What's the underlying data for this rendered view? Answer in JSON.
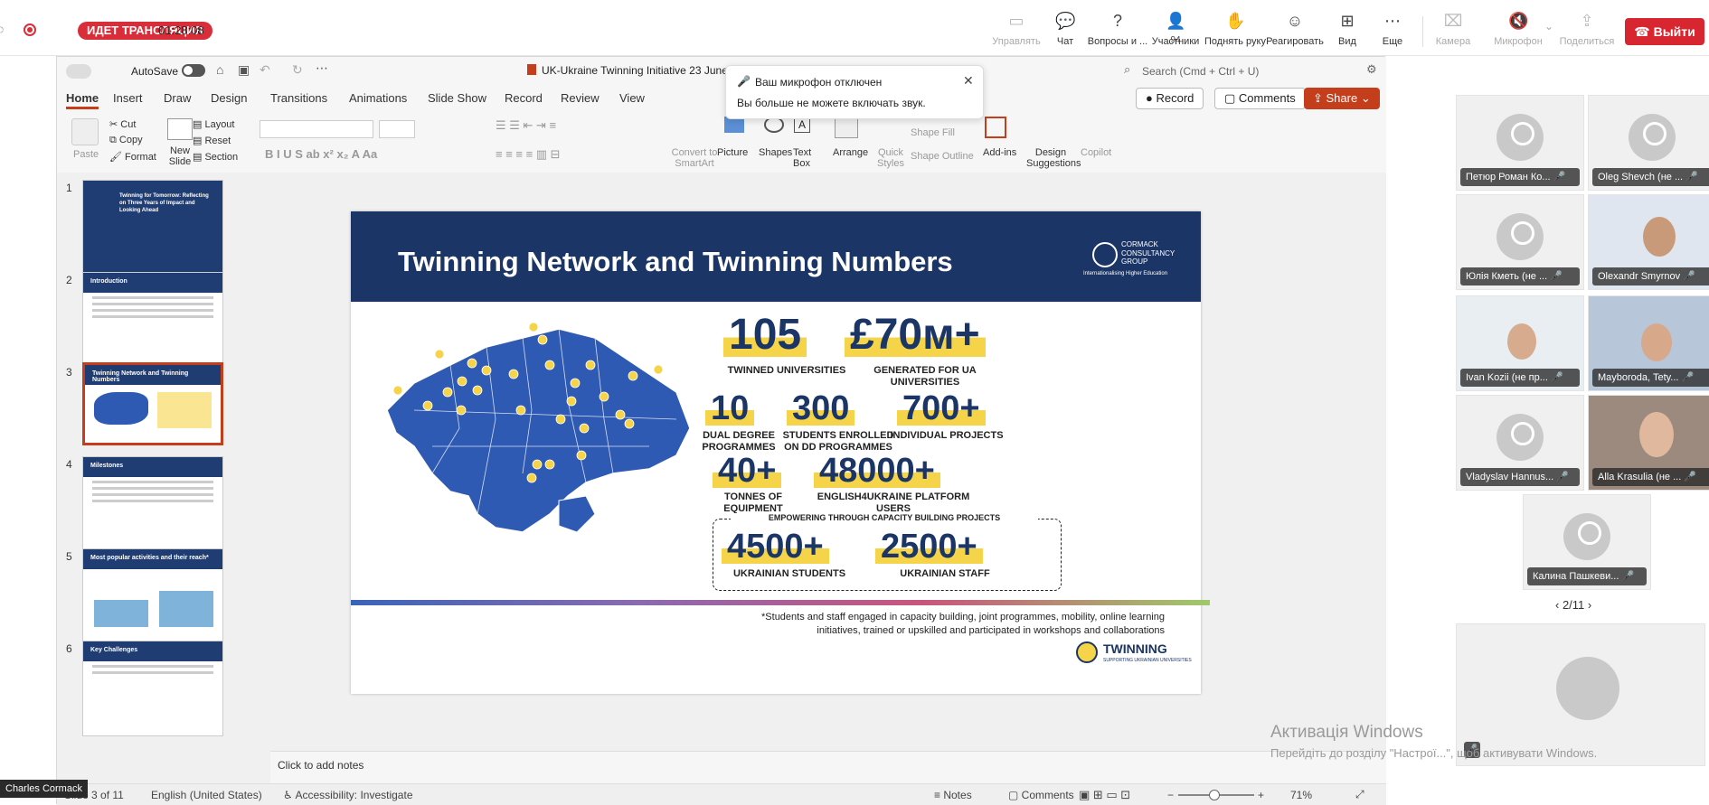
{
  "zoom": {
    "live_badge": "ИДЕТ ТРАНСЛЯЦИЯ",
    "elapsed": "01:28:08",
    "toolbar": [
      {
        "label": "Управлять",
        "icon": "share-screen-icon",
        "disabled": true
      },
      {
        "label": "Чат",
        "icon": "chat-icon"
      },
      {
        "label": "Вопросы и ...",
        "icon": "qa-icon"
      },
      {
        "label": "Участники",
        "icon": "participants-icon",
        "count": "94"
      },
      {
        "label": "Поднять руку",
        "icon": "raise-hand-icon"
      },
      {
        "label": "Реагировать",
        "icon": "smile-icon"
      },
      {
        "label": "Вид",
        "icon": "grid-view-icon"
      },
      {
        "label": "Еще",
        "icon": "more-icon"
      },
      {
        "label": "Камера",
        "icon": "camera-off-icon",
        "disabled": true
      },
      {
        "label": "Микрофон",
        "icon": "mic-off-icon",
        "disabled": true
      },
      {
        "label": "Поделиться",
        "icon": "share-icon",
        "disabled": true
      }
    ],
    "leave_label": "Выйти"
  },
  "ppt": {
    "autosave": "AutoSave",
    "doc_title": "UK-Ukraine Twinning Initiative 23 June",
    "search_placeholder": "Search (Cmd + Ctrl + U)",
    "record_label": "Record",
    "comments_label": "Comments",
    "share_label": "Share",
    "tabs": [
      "Home",
      "Insert",
      "Draw",
      "Design",
      "Transitions",
      "Animations",
      "Slide Show",
      "Record",
      "Review",
      "View"
    ],
    "ribbon": {
      "paste": "Paste",
      "cut": "Cut",
      "copy": "Copy",
      "format": "Format",
      "new_slide": "New Slide",
      "layout": "Layout",
      "reset": "Reset",
      "section": "Section",
      "convert": "Convert to SmartArt",
      "picture": "Picture",
      "shapes": "Shapes",
      "textbox": "Text Box",
      "arrange": "Arrange",
      "quick_styles": "Quick Styles",
      "shape_fill": "Shape Fill",
      "shape_outline": "Shape Outline",
      "addins": "Add-ins",
      "design_suggestions": "Design Suggestions",
      "copilot": "Copilot"
    },
    "popup": {
      "title": "Ваш микрофон отключен",
      "body": "Вы больше не можете включать звук."
    },
    "thumbnails": [
      {
        "n": "1",
        "title": "Twinning for Tomorrow: Reflecting on Three Years of Impact and Looking Ahead"
      },
      {
        "n": "2",
        "title": "Introduction"
      },
      {
        "n": "3",
        "title": "Twinning Network and Twinning Numbers"
      },
      {
        "n": "4",
        "title": "Milestones"
      },
      {
        "n": "5",
        "title": "Most popular activities and their reach*"
      },
      {
        "n": "6",
        "title": "Key Challenges"
      }
    ],
    "slide": {
      "title": "Twinning Network and Twinning Numbers",
      "logo_text": "CORMACK CONSULTANCY GROUP",
      "logo_sub": "Internationalising Higher Education",
      "stats": [
        {
          "value": "105",
          "caption": "TWINNED UNIVERSITIES"
        },
        {
          "value": "£70м+",
          "caption": "GENERATED FOR UA UNIVERSITIES"
        },
        {
          "value": "10",
          "caption": "DUAL DEGREE PROGRAMMES"
        },
        {
          "value": "300",
          "caption": "STUDENTS ENROLLED ON DD PROGRAMMES"
        },
        {
          "value": "700+",
          "caption": "INDIVIDUAL PROJECTS"
        },
        {
          "value": "40+",
          "caption": "TONNES OF EQUIPMENT"
        },
        {
          "value": "48000+",
          "caption": "ENGLISH4UKRAINE PLATFORM USERS"
        },
        {
          "value": "4500+",
          "caption": "UKRAINIAN STUDENTS"
        },
        {
          "value": "2500+",
          "caption": "UKRAINIAN STAFF"
        }
      ],
      "box_label": "EMPOWERING THROUGH CAPACITY BUILDING PROJECTS",
      "footnote": "*Students and staff engaged in capacity building, joint programmes, mobility, online learning initiatives, trained or upskilled and participated in workshops and collaborations",
      "twinning_logo": "TWINNING",
      "twinning_sub": "SUPPORTING UKRAINIAN UNIVERSITIES"
    },
    "notes_placeholder": "Click to add notes",
    "status": {
      "slide_of": "Slide 3 of 11",
      "language": "English (United States)",
      "accessibility": "Accessibility: Investigate",
      "notes": "Notes",
      "comments": "Comments",
      "zoom": "71%"
    }
  },
  "participants": {
    "tiles": [
      {
        "name": "Петюр Роман Ко..."
      },
      {
        "name": "Oleg Shevch (не ..."
      },
      {
        "name": "Юлія Кметь (не ..."
      },
      {
        "name": "Olexandr Smyrnov"
      },
      {
        "name": "Ivan Kozii (не пр..."
      },
      {
        "name": "Mayboroda, Tety..."
      },
      {
        "name": "Vladyslav Hannus..."
      },
      {
        "name": "Alla Krasulia (не ..."
      },
      {
        "name": "Калина Пашкеви..."
      }
    ],
    "pager": "2/11"
  },
  "windows_watermark": {
    "line1": "Активація Windows",
    "line2": "Перейдіть до розділу \"Настрої...\", щоб активувати Windows."
  },
  "presenter_name": "Charles Cormack"
}
